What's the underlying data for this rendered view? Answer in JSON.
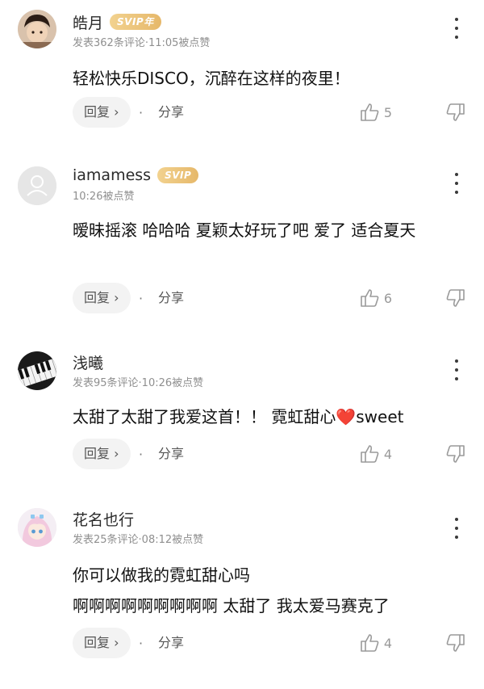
{
  "comments": [
    {
      "username": "皓月",
      "badge": "SVIP年",
      "meta": "发表362条评论·11:05被点赞",
      "content": "轻松快乐DISCO，沉醉在这样的夜里！",
      "reply_label": "回复 ›",
      "share_label": "分享",
      "like_count": "5",
      "avatar": "avatar-boy"
    },
    {
      "username": "iamamess",
      "badge": "SVIP",
      "meta": "10:26被点赞",
      "content": "暧昧摇滚 哈哈哈 夏颖太好玩了吧  爱了 适合夏天",
      "reply_label": "回复 ›",
      "share_label": "分享",
      "like_count": "6",
      "avatar": "default-user-icon"
    },
    {
      "username": "浅曦",
      "badge": "",
      "meta": "发表95条评论·10:26被点赞",
      "content": "太甜了太甜了我爱这首！！ 霓虹甜心❤️sweet",
      "reply_label": "回复 ›",
      "share_label": "分享",
      "like_count": "4",
      "avatar": "piano-keys"
    },
    {
      "username": "花名也行",
      "badge": "",
      "meta": "发表25条评论·08:12被点赞",
      "content": "你可以做我的霓虹甜心吗\n啊啊啊啊啊啊啊啊啊 太甜了  我太爱马赛克了",
      "reply_label": "回复 ›",
      "share_label": "分享",
      "like_count": "4",
      "avatar": "anime-girl"
    }
  ]
}
